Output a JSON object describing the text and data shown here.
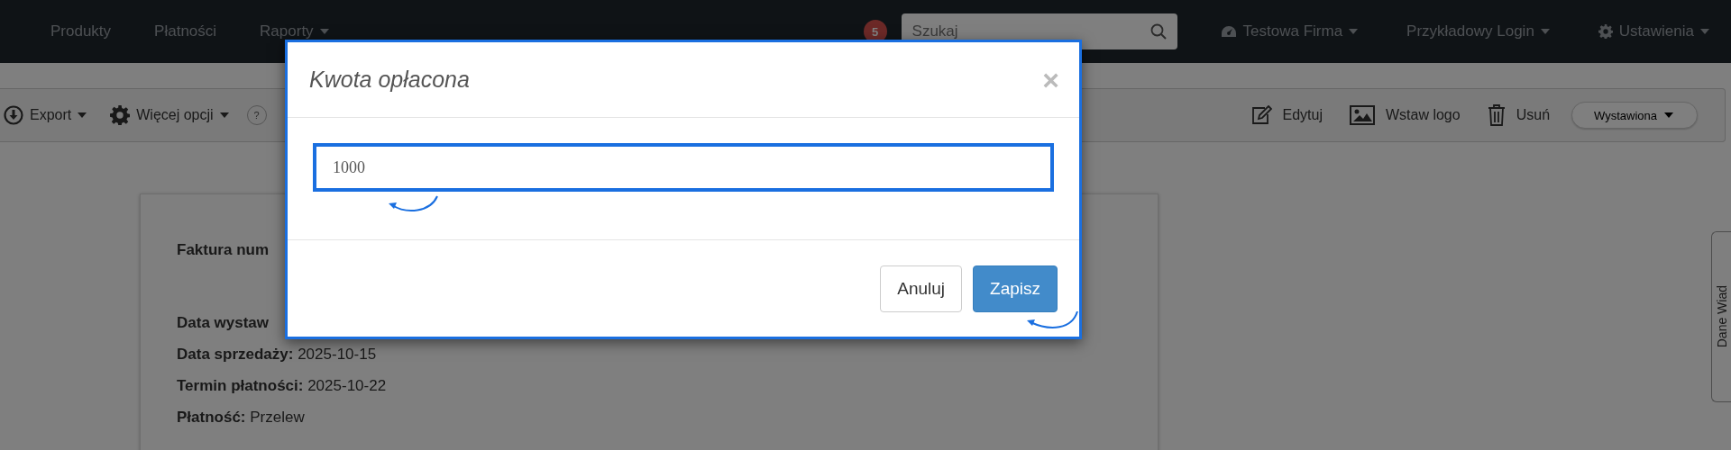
{
  "navbar": {
    "menu": [
      {
        "label": "Produkty",
        "dropdown": false
      },
      {
        "label": "Płatności",
        "dropdown": false
      },
      {
        "label": "Raporty",
        "dropdown": true
      }
    ],
    "badge": "5",
    "search": {
      "placeholder": "Szukaj"
    },
    "right": [
      {
        "label": "Testowa Firma",
        "dropdown": true
      },
      {
        "label": "Przykładowy Login",
        "dropdown": true
      },
      {
        "label": "Ustawienia",
        "dropdown": true
      }
    ]
  },
  "toolbar": {
    "left": [
      {
        "label": "Export",
        "dropdown": true
      },
      {
        "label": "Więcej opcji",
        "dropdown": true
      }
    ],
    "help": "?",
    "right": [
      {
        "label": "Edytuj"
      },
      {
        "label": "Wstaw logo"
      },
      {
        "label": "Usuń"
      }
    ],
    "status": "Wystawiona"
  },
  "invoice": {
    "lines": [
      {
        "label": "Faktura num"
      },
      {
        "label": "Data wystaw"
      },
      {
        "label": "Data sprzedaży:",
        "value": "2025-10-15"
      },
      {
        "label": "Termin płatności:",
        "value": "2025-10-22"
      },
      {
        "label": "Płatność:",
        "value": "Przelew"
      }
    ]
  },
  "side_tab": "Dane Wiad",
  "modal": {
    "title": "Kwota opłacona",
    "close": "×",
    "value": "1000",
    "buttons": [
      {
        "label": "Anuluj",
        "kind": "default"
      },
      {
        "label": "Zapisz",
        "kind": "primary"
      }
    ]
  }
}
